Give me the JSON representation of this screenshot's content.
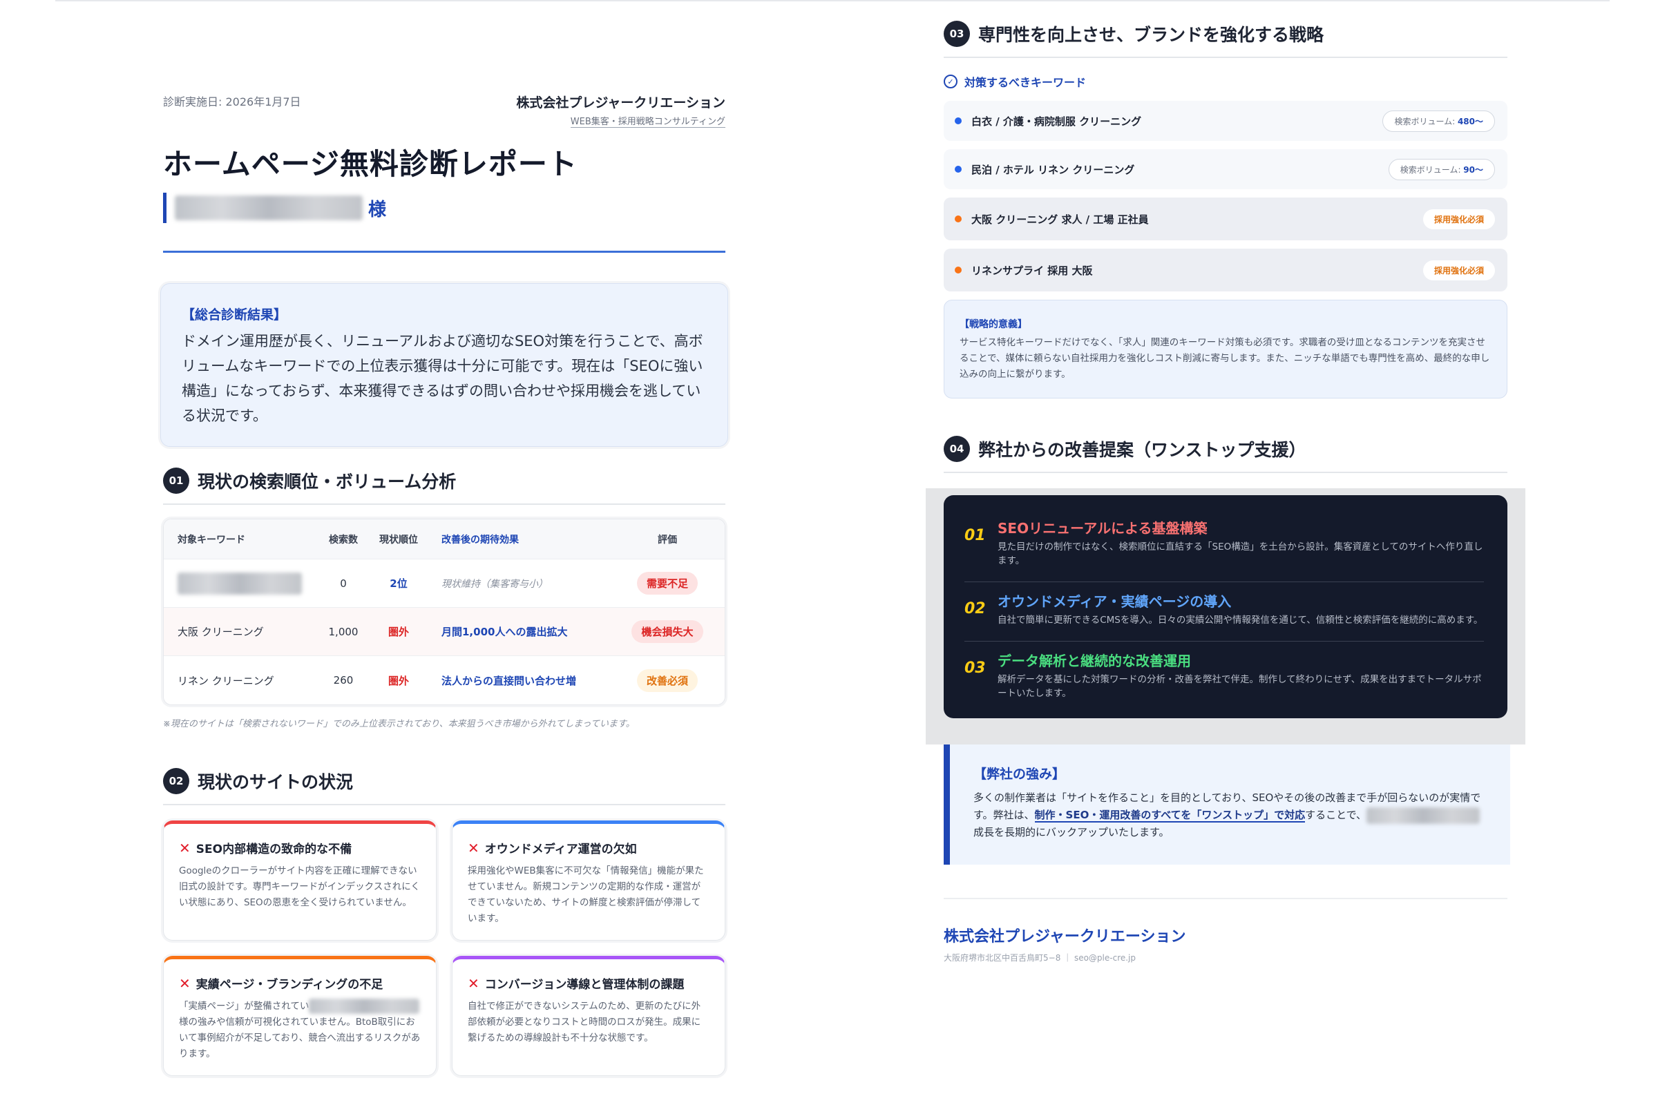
{
  "header": {
    "date": "診断実施日: 2026年1月7日",
    "company": "株式会社プレジャークリエーション",
    "company_tagline": "WEB集客・採用戦略コンサルティング"
  },
  "title": "ホームページ無料診断レポート",
  "recipient_suffix": "様",
  "summary": {
    "label": "【総合診断結果】",
    "text": "ドメイン運用歴が長く、リニューアルおよび適切なSEO対策を行うことで、高ボリュームなキーワードでの上位表示獲得は十分に可能です。現在は「SEOに強い構造」になっておらず、本来獲得できるはずの問い合わせや採用機会を逃している状況です。"
  },
  "section1": {
    "num": "01",
    "title": "現状の検索順位・ボリューム分析",
    "headers": [
      "対象キーワード",
      "検索数",
      "現状順位",
      "改善後の期待効果",
      "評価"
    ],
    "rows": [
      {
        "keyword": "",
        "volume": "0",
        "rank": "2位",
        "effect": "現状維持（集客寄与小）",
        "rating": "需要不足"
      },
      {
        "keyword": "大阪 クリーニング",
        "volume": "1,000",
        "rank": "圏外",
        "effect": "月間1,000人への露出拡大",
        "rating": "機会損失大"
      },
      {
        "keyword": "リネン クリーニング",
        "volume": "260",
        "rank": "圏外",
        "effect": "法人からの直接問い合わせ増",
        "rating": "改善必須"
      }
    ],
    "footnote": "※現在のサイトは「検索されないワード」でのみ上位表示されており、本来狙うべき市場から外れてしまっています。"
  },
  "section2": {
    "num": "02",
    "title": "現状のサイトの状況",
    "cards": [
      {
        "title": "SEO内部構造の致命的な不備",
        "text": "Googleのクローラーがサイト内容を正確に理解できない旧式の設計です。専門キーワードがインデックスされにくい状態にあり、SEOの恩恵を全く受けられていません。"
      },
      {
        "title": "オウンドメディア運営の欠如",
        "text": "採用強化やWEB集客に不可欠な「情報発信」機能が果たせていません。新規コンテンツの定期的な作成・運営ができていないため、サイトの鮮度と検索評価が停滞しています。"
      },
      {
        "title": "実績ページ・ブランディングの不足",
        "text_before": "「実績ページ」が整備されてい",
        "text_after": "様の強みや信頼が可視化されていません。BtoB取引において事例紹介が不足しており、競合へ流出するリスクがあります。"
      },
      {
        "title": "コンバージョン導線と管理体制の課題",
        "text": "自社で修正ができないシステムのため、更新のたびに外部依頼が必要となりコストと時間のロスが発生。成果に繋げるための導線設計も不十分な状態です。"
      }
    ]
  },
  "section3": {
    "num": "03",
    "title": "専門性を向上させ、ブランドを強化する戦略",
    "kw_label": "対策するべきキーワード",
    "keywords": [
      {
        "text": "白衣 / 介護・病院制服 クリーニング",
        "pill_prefix": "検索ボリューム: ",
        "pill_value": "480〜"
      },
      {
        "text": "民泊 / ホテル リネン クリーニング",
        "pill_prefix": "検索ボリューム: ",
        "pill_value": "90〜"
      },
      {
        "text": "大阪 クリーニング 求人 / 工場 正社員",
        "pill": "採用強化必須"
      },
      {
        "text": "リネンサプライ 採用 大阪",
        "pill": "採用強化必須"
      }
    ],
    "strategy_label": "【戦略的意義】",
    "strategy_text": "サービス特化キーワードだけでなく、「求人」関連のキーワード対策も必須です。求職者の受け皿となるコンテンツを充実させることで、媒体に頼らない自社採用力を強化しコスト削減に寄与します。また、ニッチな単語でも専門性を高め、最終的な申し込みの向上に繋がります。"
  },
  "section4": {
    "num": "04",
    "title": "弊社からの改善提案（ワンストップ支援）",
    "items": [
      {
        "num": "01",
        "title": "SEOリニューアルによる基盤構築",
        "text": "見た目だけの制作ではなく、検索順位に直結する「SEO構造」を土台から設計。集客資産としてのサイトへ作り直します。"
      },
      {
        "num": "02",
        "title": "オウンドメディア・実績ページの導入",
        "text": "自社で簡単に更新できるCMSを導入。日々の実績公開や情報発信を通じて、信頼性と検索評価を継続的に高めます。"
      },
      {
        "num": "03",
        "title": "データ解析と継続的な改善運用",
        "text": "解析データを基にした対策ワードの分析・改善を弊社で伴走。制作して終わりにせず、成果を出すまでトータルサポートいたします。"
      }
    ]
  },
  "strength": {
    "label": "【弊社の強み】",
    "text_before": "多くの制作業者は「サイトを作ること」を目的としており、SEOやその後の改善まで手が回らないのが実情です。弊社は、",
    "emphasis": "制作・SEO・運用改善のすべてを「ワンストップ」で対応",
    "text_middle": "することで、",
    "text_after": "成長を長期的にバックアップいたします。"
  },
  "footer": {
    "company": "株式会社プレジャークリエーション",
    "address": "大阪府堺市北区中百舌鳥町5−8 ｜ seo@ple-cre.jp"
  },
  "colors": {
    "accent": "#1e46b4",
    "dark": "#141a2b",
    "red": "#dc2626",
    "orange": "#f97316"
  }
}
